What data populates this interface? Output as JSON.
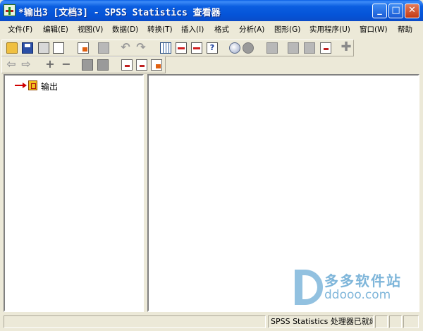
{
  "window": {
    "title": "*输出3 [文档3] - SPSS Statistics 查看器",
    "minimize": "_",
    "maximize": "□",
    "close": "✕"
  },
  "menu": [
    "文件(F)",
    "编辑(E)",
    "视图(V)",
    "数据(D)",
    "转换(T)",
    "插入(I)",
    "格式",
    "分析(A)",
    "图形(G)",
    "实用程序(U)",
    "窗口(W)",
    "帮助"
  ],
  "toolbar1_icons": [
    "open-folder-icon",
    "save-icon",
    "print-icon",
    "print-preview-icon",
    "export-icon",
    "gray-doc-icon",
    "undo-icon",
    "redo-icon",
    "data-editor-icon",
    "goto-case-icon",
    "goto-variable-icon",
    "variables-icon",
    "use-sets-icon",
    "show-all-icons",
    "insert-cases-icon",
    "insert-output-icon",
    "shop-icon",
    "pivot-icon",
    "add-icon"
  ],
  "toolbar2_icons": [
    "back-arrow-icon",
    "forward-arrow-icon",
    "expand-icon",
    "collapse-icon",
    "show-icon",
    "hide-icon",
    "insert-heading-icon",
    "insert-title-icon",
    "insert-text-icon"
  ],
  "tree": {
    "root_label": "输出"
  },
  "status": {
    "left": "",
    "processor": "SPSS Statistics  处理器已就绪",
    "cell1": "",
    "cell2": "",
    "cell3": ""
  },
  "watermark": {
    "name": "多多软件站",
    "url": "ddooo.com"
  }
}
